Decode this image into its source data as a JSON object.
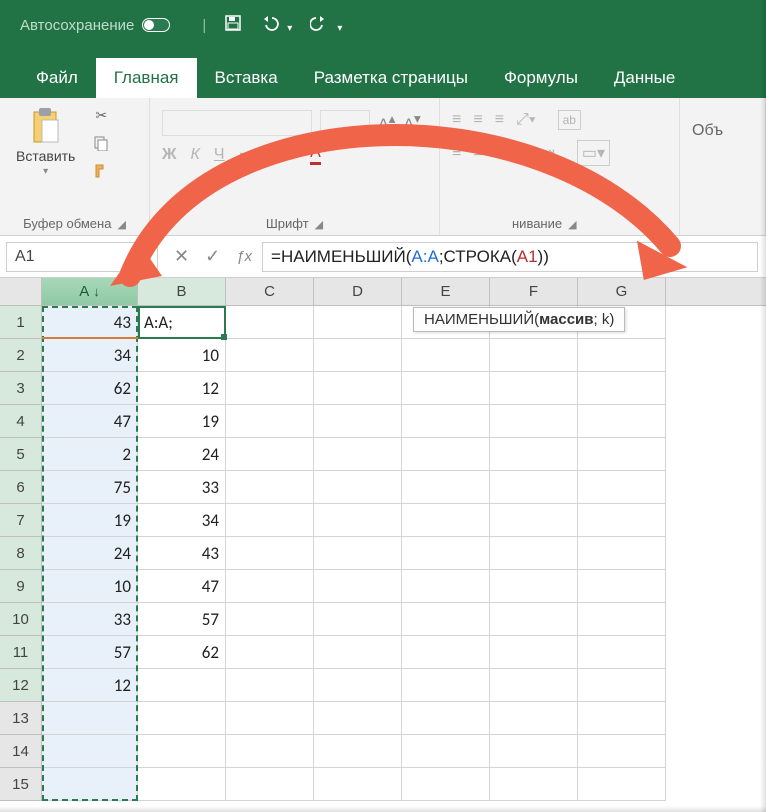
{
  "titlebar": {
    "autosave_label": "Автосохранение",
    "qat_icons": [
      "save-icon",
      "undo-icon",
      "redo-icon"
    ]
  },
  "tabs": [
    {
      "id": "file",
      "label": "Файл"
    },
    {
      "id": "home",
      "label": "Главная",
      "active": true
    },
    {
      "id": "insert",
      "label": "Вставка"
    },
    {
      "id": "layout",
      "label": "Разметка страницы"
    },
    {
      "id": "formulas",
      "label": "Формулы"
    },
    {
      "id": "data",
      "label": "Данные"
    }
  ],
  "ribbon": {
    "clipboard": {
      "paste": "Вставить",
      "label": "Буфер обмена"
    },
    "font": {
      "label": "Шрифт",
      "btns": [
        "Ж",
        "К",
        "Ч"
      ]
    },
    "align": {
      "label": "Выравнивание",
      "btn": "Объ"
    },
    "wrap_icon": "ab"
  },
  "fxbar": {
    "namebox": "A1",
    "formula_prefix": "=НАИМЕНЬШИЙ(",
    "formula_ref1": "A:A",
    "formula_mid": ";СТРОКА(",
    "formula_ref2": "A1",
    "formula_end": "))",
    "tooltip_fn": "НАИМЕНЬШИЙ(",
    "tooltip_arg_bold": "массив",
    "tooltip_rest": "; k)"
  },
  "columns": [
    "A",
    "B",
    "C",
    "D",
    "E",
    "F",
    "G"
  ],
  "colA": [
    43,
    34,
    62,
    47,
    2,
    75,
    19,
    24,
    10,
    33,
    57,
    12
  ],
  "colB_first": "A:A;",
  "colB": [
    null,
    10,
    12,
    19,
    24,
    33,
    34,
    43,
    47,
    57,
    62
  ],
  "rows_shown": 15,
  "colors": {
    "accent": "#217346",
    "arrow": "#f0654a"
  }
}
